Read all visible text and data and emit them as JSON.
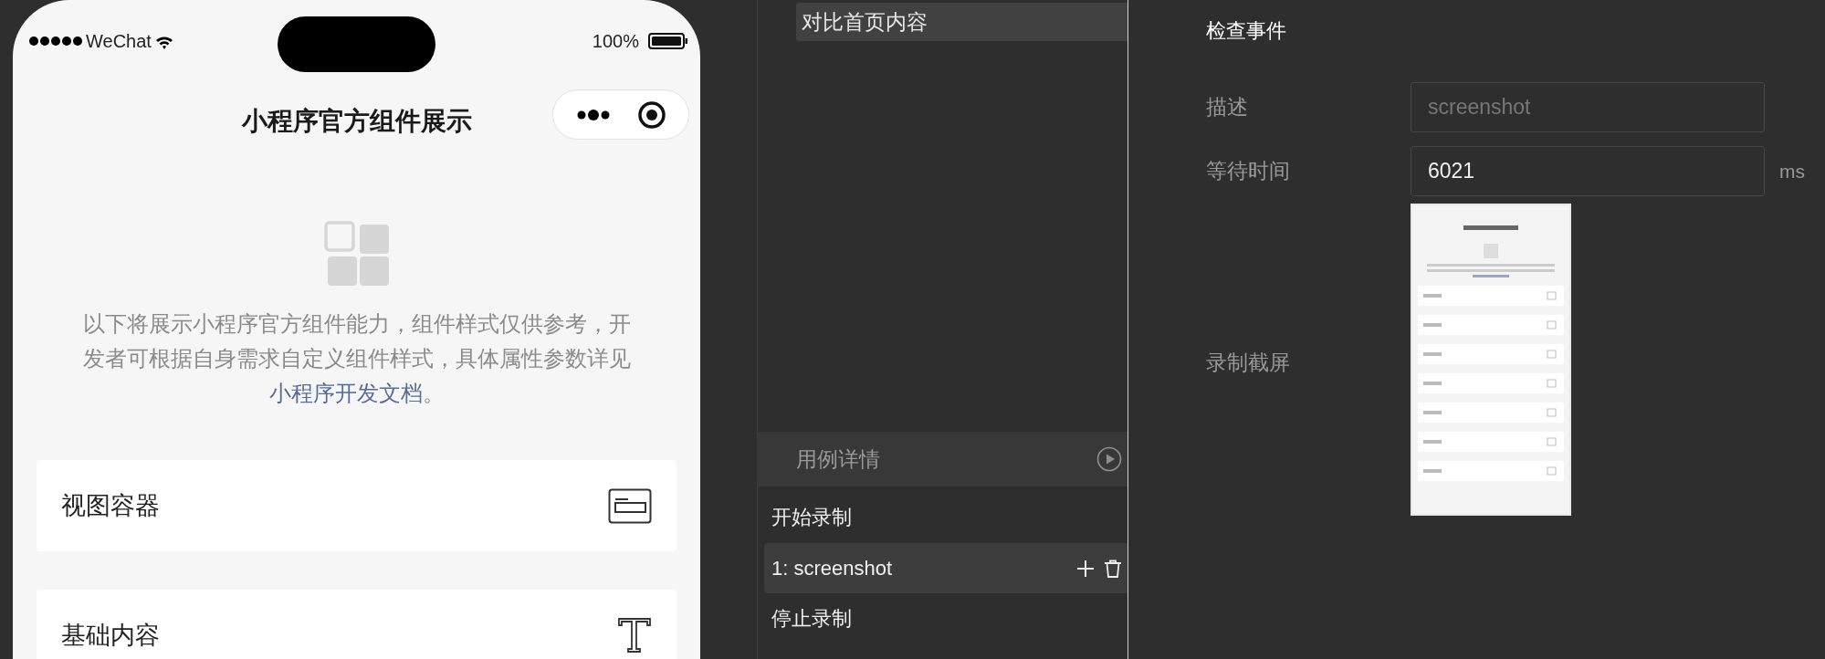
{
  "phone": {
    "status_bar": {
      "carrier": "WeChat",
      "battery": "100%"
    },
    "title": "小程序官方组件展示",
    "intro": {
      "text": "以下将展示小程序官方组件能力，组件样式仅供参考，开发者可根据自身需求自定义组件样式，具体属性参数详见",
      "link": "小程序开发文档",
      "tail": "。"
    },
    "menu": [
      {
        "label": "视图容器",
        "kind": "view"
      },
      {
        "label": "基础内容",
        "kind": "text"
      }
    ]
  },
  "case_panel": {
    "items": [
      {
        "label": "对比首页内容",
        "selected": true
      }
    ],
    "section": {
      "title": "用例详情"
    },
    "steps": [
      {
        "label": "开始录制",
        "kind": "marker",
        "selected": false
      },
      {
        "label": "1: screenshot",
        "kind": "step",
        "selected": true
      },
      {
        "label": "停止录制",
        "kind": "marker",
        "selected": false
      }
    ]
  },
  "event_panel": {
    "title": "检查事件",
    "fields": [
      {
        "label": "描述",
        "placeholder": "screenshot"
      },
      {
        "label": "等待时间",
        "value": "6021",
        "unit": "ms"
      }
    ],
    "screenshot": {
      "label": "录制截屏"
    }
  }
}
